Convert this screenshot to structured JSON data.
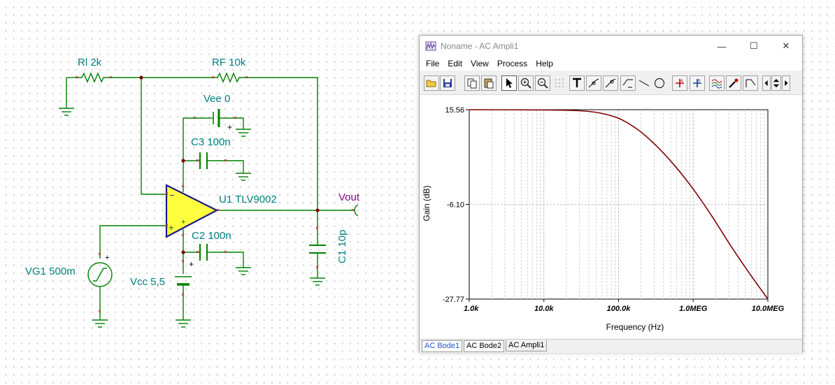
{
  "schematic": {
    "labels": {
      "rl": "Rl 2k",
      "rf": "RF 10k",
      "vee": "Vee 0",
      "c3": "C3 100n",
      "u1": "U1 TLV9002",
      "vout": "Vout",
      "c2": "C2 100n",
      "c1": "C1 10p",
      "vg1": "VG1 500m",
      "vcc": "Vcc 5,5"
    },
    "colors": {
      "wire": "#008000",
      "label": "#008080",
      "opamp_fill": "#ffff40",
      "opamp_stroke": "#1a1a8c",
      "node": "#800000",
      "vout_label": "#8a008a"
    }
  },
  "window": {
    "title": "Noname - AC Ampli1",
    "controls": {
      "minimize": "—",
      "maximize": "☐",
      "close": "✕"
    },
    "menu": [
      "File",
      "Edit",
      "View",
      "Process",
      "Help"
    ],
    "toolbar_icons": [
      "open-folder-icon",
      "save-icon",
      "copy-icon",
      "paste-icon",
      "pointer-icon",
      "zoom-in-icon",
      "zoom-out-icon",
      "grid-icon",
      "text-icon",
      "cursor-a-icon",
      "cursor-b-icon",
      "line-draw-icon",
      "line-icon",
      "circle-icon",
      "cross-a-icon",
      "cross-b-icon",
      "waves-icon",
      "probe-icon",
      "slope-icon",
      "arrow-left-icon",
      "arrow-updown-icon",
      "arrow-right-icon"
    ],
    "tabs": [
      "AC Bode1",
      "AC Bode2",
      "AC Ampli1"
    ]
  },
  "chart_data": {
    "type": "line",
    "xlabel": "Frequency (Hz)",
    "ylabel": "Gain (dB)",
    "x_scale": "log",
    "xlim": [
      1000,
      10000000
    ],
    "ylim": [
      -27.77,
      15.56
    ],
    "x_tick_labels": [
      "1.0k",
      "10.0k",
      "100.0k",
      "1.0MEG",
      "10.0MEG"
    ],
    "x_tick_values": [
      1000,
      10000,
      100000,
      1000000,
      10000000
    ],
    "y_tick_labels": [
      "15.56",
      "-6.10",
      "-27.77"
    ],
    "y_tick_values": [
      15.56,
      -6.1,
      -27.77
    ],
    "grid": true,
    "series": [
      {
        "color": "#800000",
        "x": [
          1000,
          10000,
          31623,
          56234,
          100000,
          177828,
          316228,
          562341,
          1000000,
          1778279,
          3162278,
          5623413,
          10000000
        ],
        "y": [
          15.56,
          15.5,
          15.3,
          14.8,
          13.6,
          11.1,
          7.4,
          2.8,
          -2.6,
          -8.8,
          -15.5,
          -21.8,
          -27.77
        ]
      }
    ]
  }
}
